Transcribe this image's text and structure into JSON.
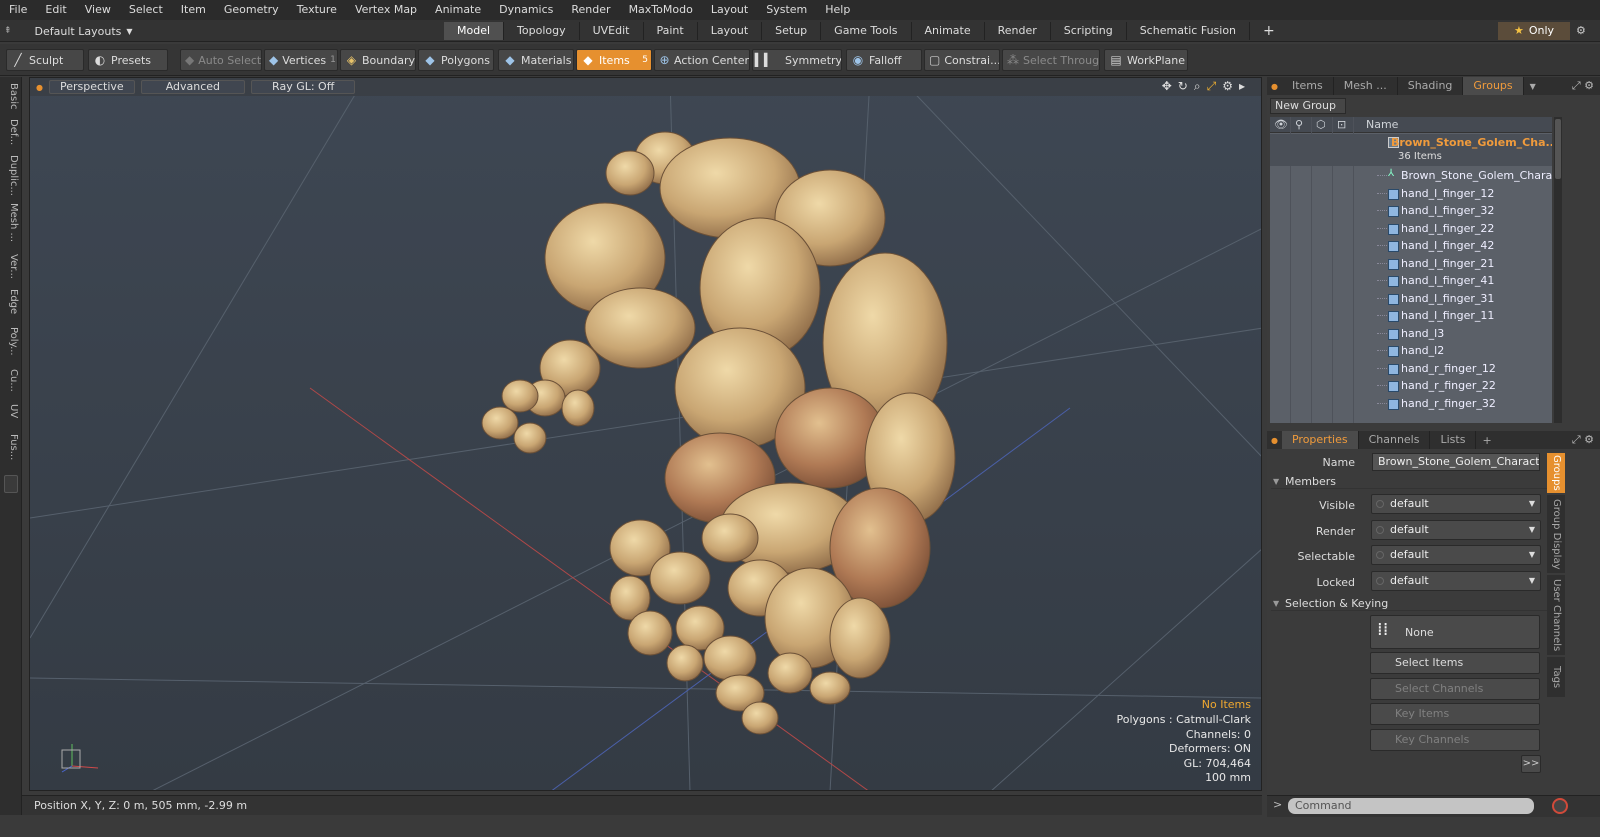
{
  "menu": [
    "File",
    "Edit",
    "View",
    "Select",
    "Item",
    "Geometry",
    "Texture",
    "Vertex Map",
    "Animate",
    "Dynamics",
    "Render",
    "MaxToModo",
    "Layout",
    "System",
    "Help"
  ],
  "layout_selector": "Default Layouts",
  "layout_tabs": [
    "Model",
    "Topology",
    "UVEdit",
    "Paint",
    "Layout",
    "Setup",
    "Game Tools",
    "Animate",
    "Render",
    "Scripting",
    "Schematic Fusion"
  ],
  "active_layout_tab": "Model",
  "only_button": "Only",
  "toolbar": {
    "sculpt": "Sculpt",
    "presets": "Presets",
    "auto_select": "Auto Select",
    "vertices": "Vertices",
    "vertices_count": "1",
    "boundary": "Boundary",
    "polygons": "Polygons",
    "materials": "Materials",
    "items": "Items",
    "items_count": "5",
    "action_center": "Action Center",
    "symmetry": "Symmetry",
    "falloff": "Falloff",
    "constraints": "Constrai...",
    "select_through": "Select Through",
    "workplane": "WorkPlane"
  },
  "left_tabs": [
    "Basic",
    "Def...",
    "Duplic...",
    "Mesh ...",
    "Ver...",
    "Edge",
    "Poly...",
    "Cu...",
    "UV",
    "Fus..."
  ],
  "viewport": {
    "buttons": [
      "Perspective",
      "Advanced",
      "Ray GL: Off"
    ],
    "hud": {
      "selection": "No Items",
      "polygons": "Polygons : Catmull-Clark",
      "channels": "Channels: 0",
      "deformers": "Deformers: ON",
      "gl": "GL: 704,464",
      "unit": "100 mm"
    }
  },
  "status": "Position X, Y, Z:   0 m, 505 mm, -2.99 m",
  "groups_panel": {
    "tabs": [
      "Items",
      "Mesh ...",
      "Shading",
      "Groups"
    ],
    "active_tab": "Groups",
    "new_group": "New Group",
    "column_name": "Name",
    "group_name": "Brown_Stone_Golem_Cha...",
    "group_count": "36 Items",
    "items": [
      "Brown_Stone_Golem_Chara...",
      "hand_l_finger_12",
      "hand_l_finger_32",
      "hand_l_finger_22",
      "hand_l_finger_42",
      "hand_l_finger_21",
      "hand_l_finger_41",
      "hand_l_finger_31",
      "hand_l_finger_11",
      "hand_l3",
      "hand_l2",
      "hand_r_finger_12",
      "hand_r_finger_22",
      "hand_r_finger_32"
    ]
  },
  "properties_panel": {
    "tabs": [
      "Properties",
      "Channels",
      "Lists"
    ],
    "active_tab": "Properties",
    "name_label": "Name",
    "name_value": "Brown_Stone_Golem_Character_",
    "members_section": "Members",
    "visible_label": "Visible",
    "visible_value": "default",
    "render_label": "Render",
    "render_value": "default",
    "selectable_label": "Selectable",
    "selectable_value": "default",
    "locked_label": "Locked",
    "locked_value": "default",
    "keying_section": "Selection & Keying",
    "none_button": "None",
    "select_items": "Select Items",
    "select_channels": "Select Channels",
    "key_items": "Key Items",
    "key_channels": "Key Channels",
    "more": ">>",
    "side_tabs": [
      "Groups",
      "Group Display",
      "User Channels",
      "Tags"
    ]
  },
  "command_placeholder": "Command",
  "colors": {
    "accent": "#e6902f",
    "viewport_bg": "#3c4550",
    "group_highlight": "#f09b3c"
  }
}
